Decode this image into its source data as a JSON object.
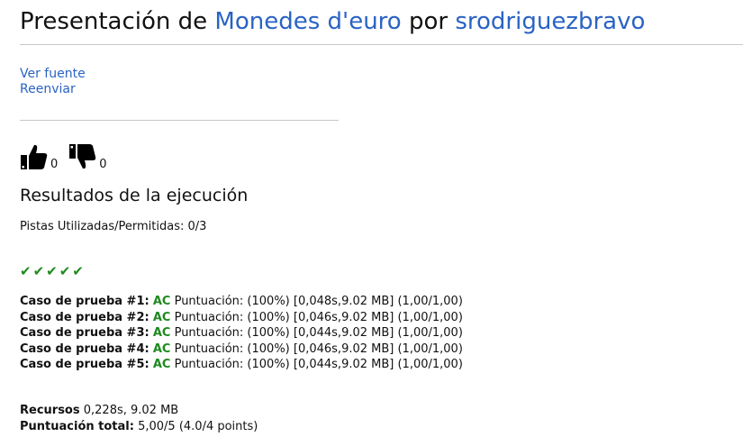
{
  "header": {
    "prefix": "Presentación de",
    "problem_link": "Monedes d'euro",
    "joiner": "por",
    "user_link": "srodriguezbravo"
  },
  "actions": {
    "view_source": "Ver fuente",
    "resubmit": "Reenviar"
  },
  "votes": {
    "up_icon": "thumbs-up-icon",
    "up_count": "0",
    "down_icon": "thumbs-down-icon",
    "down_count": "0"
  },
  "results": {
    "heading": "Resultados de la ejecución",
    "hints": "Pistas Utilizadas/Permitidas: 0/3",
    "checks": "✔✔✔✔✔",
    "check_color": "#1e8a1e",
    "cases": [
      {
        "label": "Caso de prueba #1:",
        "verdict": "AC",
        "details": "Puntuación: (100%) [0,048s,9.02 MB] (1,00/1,00)"
      },
      {
        "label": "Caso de prueba #2:",
        "verdict": "AC",
        "details": "Puntuación: (100%) [0,046s,9.02 MB] (1,00/1,00)"
      },
      {
        "label": "Caso de prueba #3:",
        "verdict": "AC",
        "details": "Puntuación: (100%) [0,044s,9.02 MB] (1,00/1,00)"
      },
      {
        "label": "Caso de prueba #4:",
        "verdict": "AC",
        "details": "Puntuación: (100%) [0,046s,9.02 MB] (1,00/1,00)"
      },
      {
        "label": "Caso de prueba #5:",
        "verdict": "AC",
        "details": "Puntuación: (100%) [0,044s,9.02 MB] (1,00/1,00)"
      }
    ]
  },
  "summary": {
    "resources_label": "Recursos",
    "resources_value": "0,228s, 9.02 MB",
    "total_label": "Puntuación total:",
    "total_value": "5,00/5 (4.0/4 points)"
  },
  "colors": {
    "link": "#2a63c4",
    "accepted": "#1e8a1e"
  }
}
